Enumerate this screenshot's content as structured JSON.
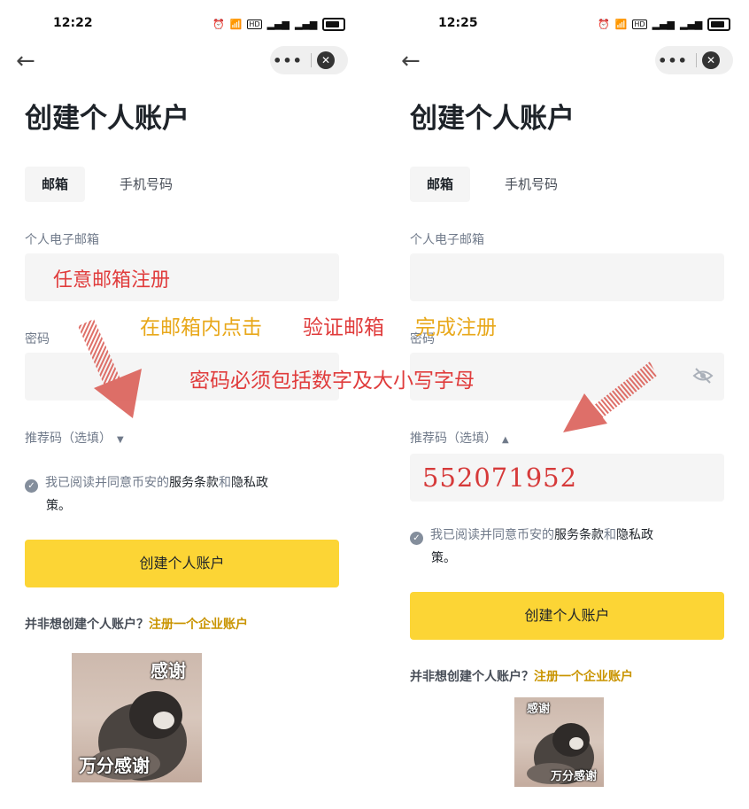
{
  "colors": {
    "accent": "#fcd535",
    "link": "#c99400",
    "annotation_red": "#e03c3c",
    "annotation_yellow": "#e8a81b"
  },
  "left": {
    "time": "12:22",
    "title": "创建个人账户",
    "tabs": [
      "邮箱",
      "手机号码"
    ],
    "email_label": "个人电子邮箱",
    "email_hint": "任意邮箱注册",
    "password_label": "密码",
    "referral_label": "推荐码（选填）",
    "referral_caret": "▼",
    "agree_prefix": "我已阅读并同意币安的",
    "agree_terms": "服务条款",
    "agree_and": "和",
    "agree_privacy": "隐私政",
    "agree_end": "策。",
    "button": "创建个人账户",
    "notice_text": "并非想创建个人账户？",
    "notice_link": "注册一个企业账户",
    "meme_top": "感谢",
    "meme_bottom": "万分感谢"
  },
  "right": {
    "time": "12:25",
    "title": "创建个人账户",
    "tabs": [
      "邮箱",
      "手机号码"
    ],
    "email_label": "个人电子邮箱",
    "password_label": "密码",
    "referral_label": "推荐码（选填）",
    "referral_caret": "▲",
    "referral_code": "552071952",
    "agree_prefix": "我已阅读并同意币安的",
    "agree_terms": "服务条款",
    "agree_and": "和",
    "agree_privacy": "隐私政",
    "agree_end": "策。",
    "button": "创建个人账户",
    "notice_text": "并非想创建个人账户？",
    "notice_link": "注册一个企业账户",
    "meme_top": "感谢",
    "meme_bottom": "万分感谢"
  },
  "status_icons": [
    "alarm-icon",
    "wifi-icon",
    "hd-icon",
    "signal-icon",
    "signal-icon",
    "battery-icon"
  ],
  "overlay": {
    "line1a": "在邮箱内点击",
    "line1b": "验证邮箱",
    "line1c": "完成注册",
    "line2": "密码必须包括数字及大小写字母"
  }
}
